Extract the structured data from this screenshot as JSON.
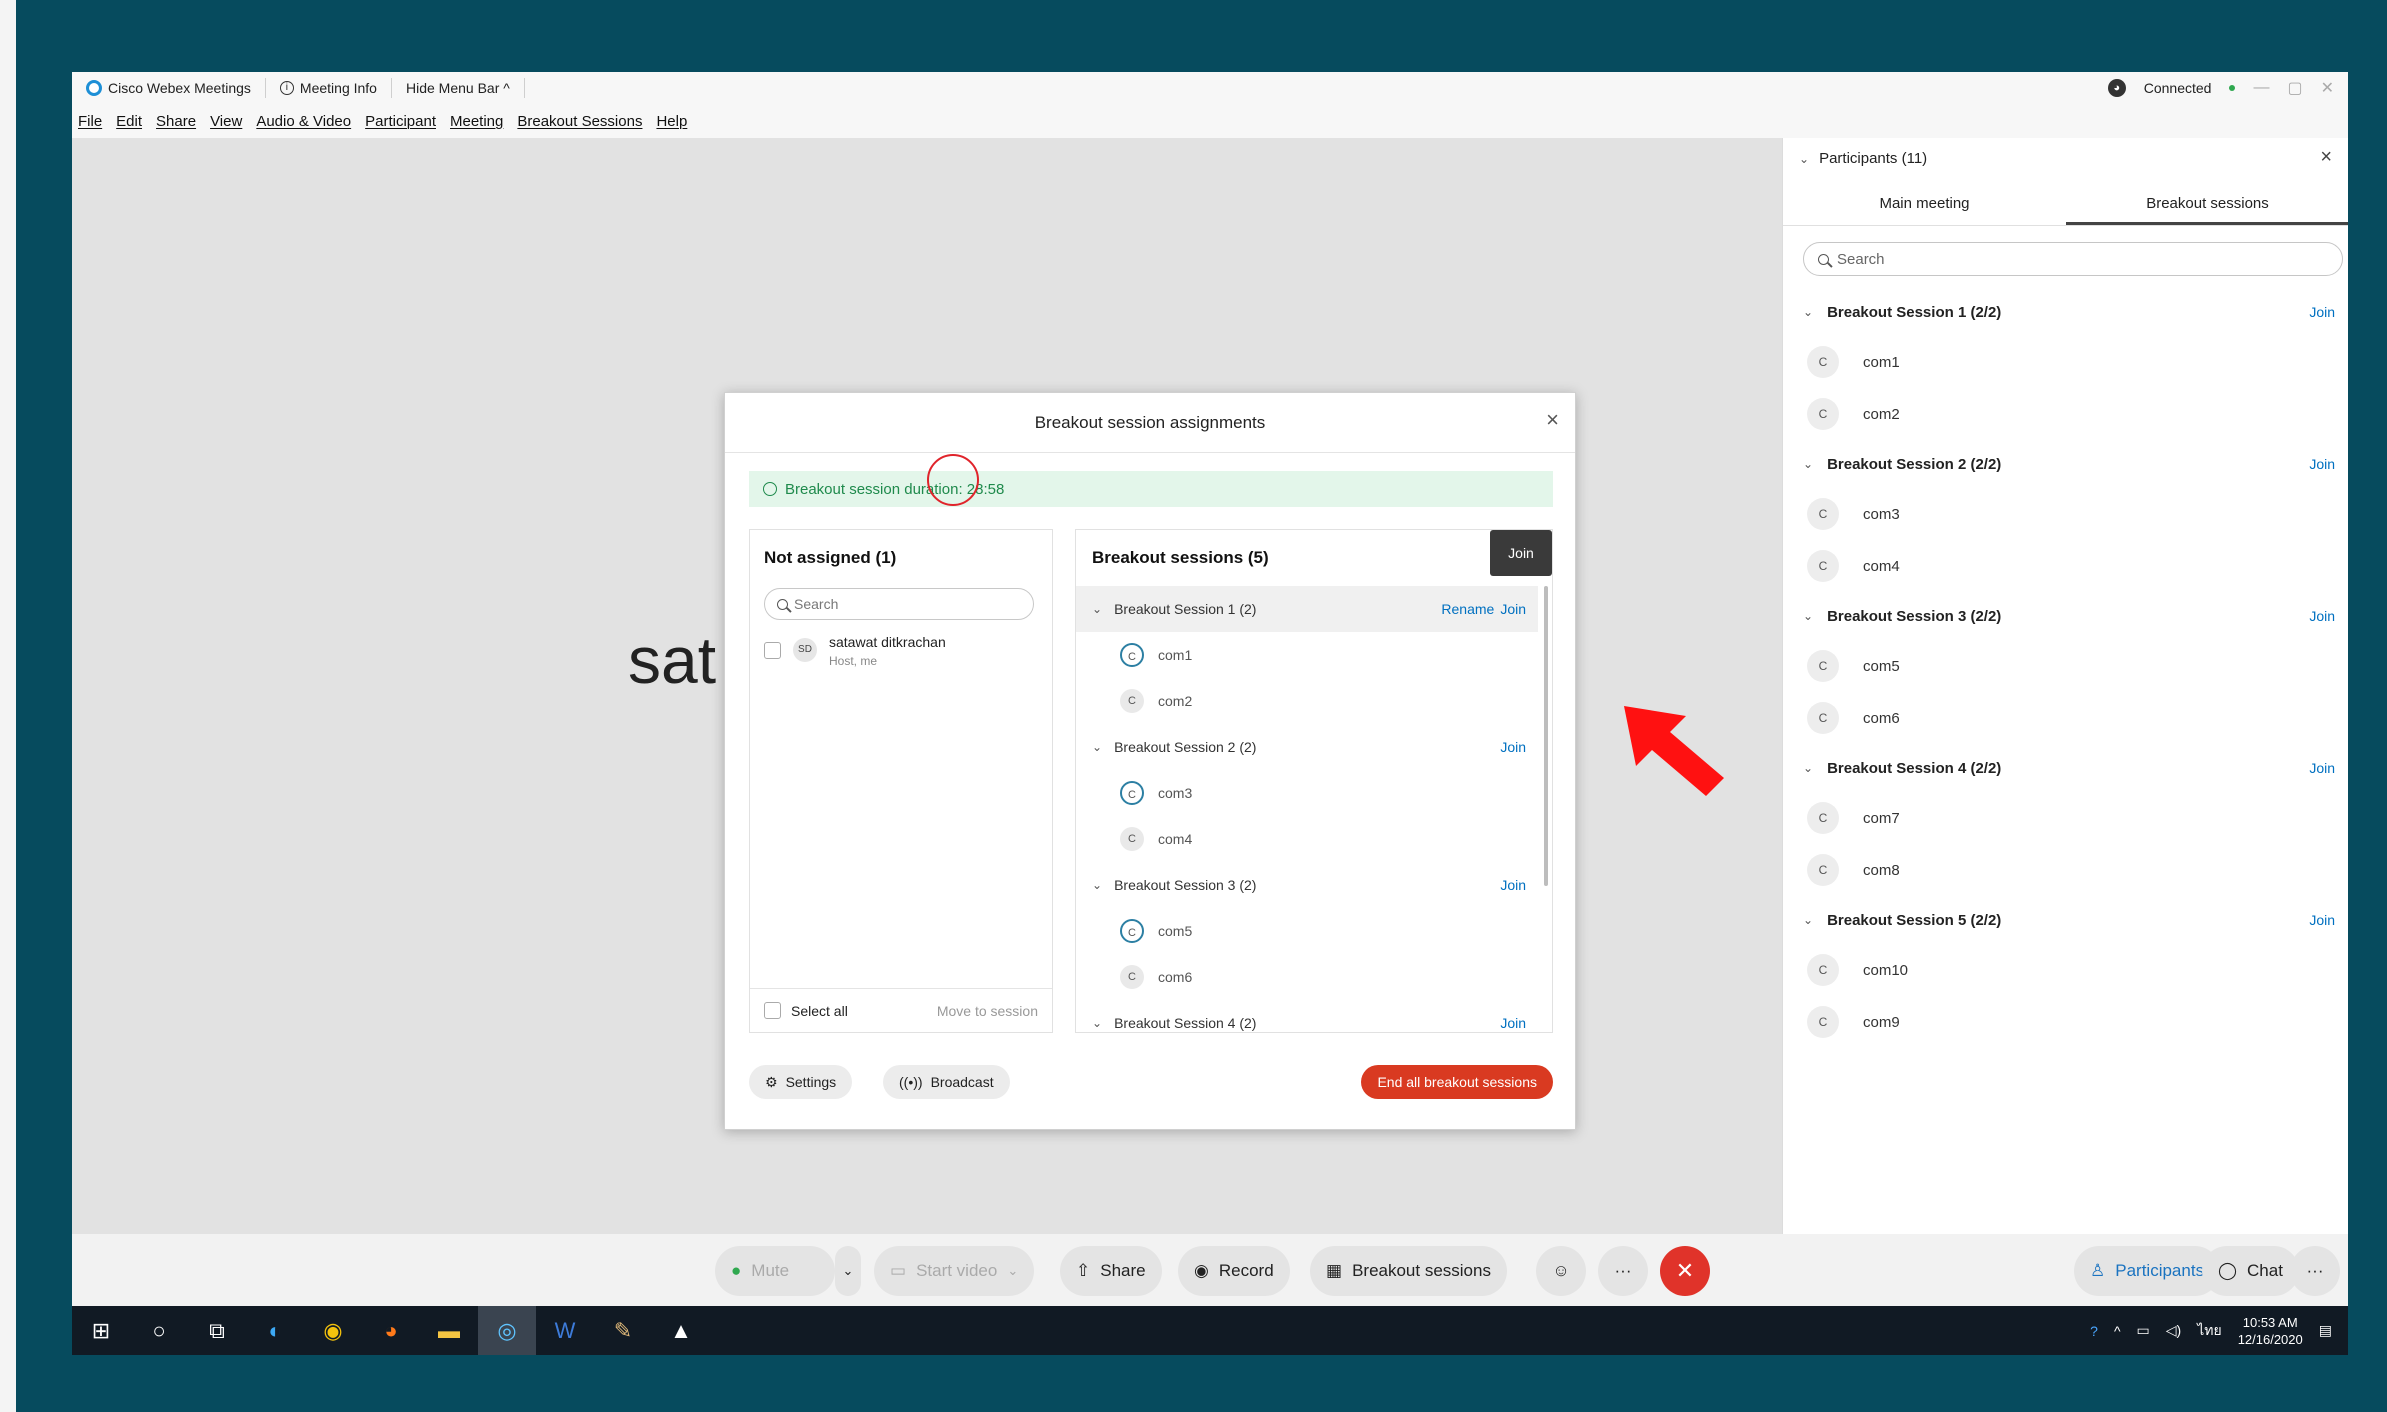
{
  "titlebar": {
    "app_name": "Cisco Webex Meetings",
    "meeting_info": "Meeting Info",
    "hide_menu": "Hide Menu Bar ^",
    "connected": "Connected",
    "minimize": "—",
    "maximize": "▢",
    "close": "✕"
  },
  "menubar": [
    "File",
    "Edit",
    "Share",
    "View",
    "Audio & Video",
    "Participant",
    "Meeting",
    "Breakout Sessions",
    "Help"
  ],
  "stage": {
    "name_partial": "sat"
  },
  "dialog": {
    "title": "Breakout session assignments",
    "close": "×",
    "duration": "Breakout session duration: 28:58",
    "not_assigned": {
      "title": "Not assigned (1)",
      "search_placeholder": "Search",
      "user_initials": "SD",
      "user_name": "satawat ditkrachan",
      "user_role": "Host, me",
      "select_all": "Select all",
      "move_to_session": "Move to session"
    },
    "sessions_panel": {
      "title": "Breakout sessions  (5)",
      "tooltip": "Join",
      "rename": "Rename",
      "join": "Join",
      "sessions": [
        {
          "name": "Breakout Session 1 (2)",
          "members": [
            "com1",
            "com2"
          ]
        },
        {
          "name": "Breakout Session 2 (2)",
          "members": [
            "com3",
            "com4"
          ]
        },
        {
          "name": "Breakout Session 3 (2)",
          "members": [
            "com5",
            "com6"
          ]
        },
        {
          "name": "Breakout Session 4 (2)",
          "members": []
        }
      ]
    },
    "footer": {
      "settings": "Settings",
      "broadcast": "Broadcast",
      "end_all": "End all breakout sessions"
    }
  },
  "participants_panel": {
    "title": "Participants (11)",
    "close": "×",
    "tabs": [
      "Main meeting",
      "Breakout sessions"
    ],
    "search_placeholder": "Search",
    "join": "Join",
    "sessions": [
      {
        "name": "Breakout Session 1 (2/2)",
        "members": [
          "com1",
          "com2"
        ]
      },
      {
        "name": "Breakout Session 2 (2/2)",
        "members": [
          "com3",
          "com4"
        ]
      },
      {
        "name": "Breakout Session 3 (2/2)",
        "members": [
          "com5",
          "com6"
        ]
      },
      {
        "name": "Breakout Session 4 (2/2)",
        "members": [
          "com7",
          "com8"
        ]
      },
      {
        "name": "Breakout Session 5 (2/2)",
        "members": [
          "com10",
          "com9"
        ]
      }
    ],
    "avatar_initial": "C"
  },
  "controls": {
    "mute": "Mute",
    "start_video": "Start video",
    "share": "Share",
    "record": "Record",
    "breakout_sessions": "Breakout sessions",
    "more": "···",
    "end": "✕",
    "participants": "Participants",
    "chat": "Chat"
  },
  "taskbar": {
    "time": "10:53 AM",
    "date": "12/16/2020",
    "lang": "ไทย"
  },
  "colors": {
    "accent_blue": "#0070c0",
    "end_red": "#d93a21",
    "duration_green": "#1f8a4c",
    "background_teal": "#064b5e"
  }
}
